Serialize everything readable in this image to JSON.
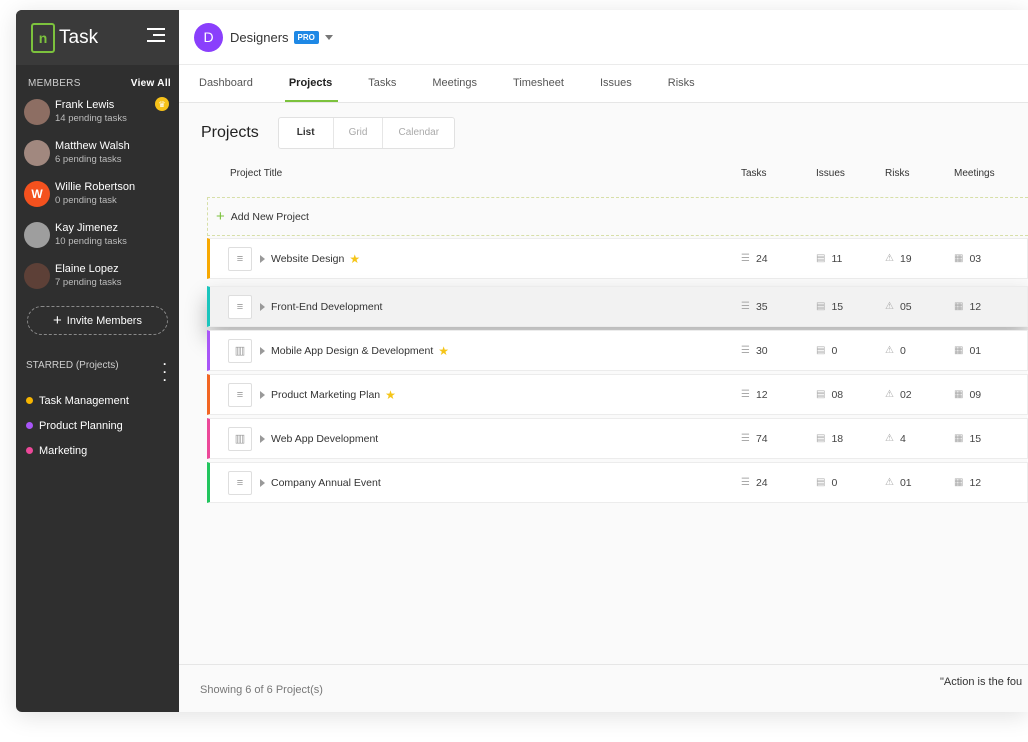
{
  "app": {
    "logo_mark": "n",
    "logo_text": "Task"
  },
  "sidebar": {
    "members_label": "MEMBERS",
    "view_all": "View All",
    "members": [
      {
        "name": "Frank Lewis",
        "sub": "14 pending tasks",
        "initial": "",
        "color": "#8d6e63"
      },
      {
        "name": "Matthew Walsh",
        "sub": "6 pending tasks",
        "initial": "",
        "color": "#a1887f"
      },
      {
        "name": "Willie Robertson",
        "sub": "0 pending task",
        "initial": "W",
        "color": "#f4511e"
      },
      {
        "name": "Kay Jimenez",
        "sub": "10 pending tasks",
        "initial": "",
        "color": "#9e9e9e"
      },
      {
        "name": "Elaine Lopez",
        "sub": "7 pending tasks",
        "initial": "",
        "color": "#5d4037"
      }
    ],
    "invite_label": "Invite Members",
    "starred_label": "STARRED (Projects)",
    "starred": [
      {
        "label": "Task Management",
        "color": "#f7b500"
      },
      {
        "label": "Product Planning",
        "color": "#a855f7"
      },
      {
        "label": "Marketing",
        "color": "#ec4899"
      }
    ]
  },
  "workspace": {
    "initial": "D",
    "name": "Designers",
    "badge": "PRO"
  },
  "tabs": [
    "Dashboard",
    "Projects",
    "Tasks",
    "Meetings",
    "Timesheet",
    "Issues",
    "Risks"
  ],
  "page": {
    "title": "Projects",
    "views": [
      "List",
      "Grid",
      "Calendar"
    ]
  },
  "table": {
    "headers": {
      "title": "Project Title",
      "tasks": "Tasks",
      "issues": "Issues",
      "risks": "Risks",
      "meetings": "Meetings"
    },
    "add_label": "Add New Project",
    "rows": [
      {
        "title": "Website Design",
        "starred": true,
        "color": "#f7a800",
        "tasks": "24",
        "issues": "11",
        "risks": "19",
        "meetings": "03",
        "icon": "list"
      },
      {
        "title": "Front-End Development",
        "starred": false,
        "color": "#1bc5bd",
        "tasks": "35",
        "issues": "15",
        "risks": "05",
        "meetings": "12",
        "icon": "list"
      },
      {
        "title": "Mobile App Design & Development",
        "starred": true,
        "color": "#a855f7",
        "tasks": "30",
        "issues": "0",
        "risks": "0",
        "meetings": "01",
        "icon": "board"
      },
      {
        "title": "Product Marketing Plan",
        "starred": true,
        "color": "#f26522",
        "tasks": "12",
        "issues": "08",
        "risks": "02",
        "meetings": "09",
        "icon": "list"
      },
      {
        "title": "Web App Development",
        "starred": false,
        "color": "#ec4899",
        "tasks": "74",
        "issues": "18",
        "risks": "4",
        "meetings": "15",
        "icon": "board"
      },
      {
        "title": "Company Annual Event",
        "starred": false,
        "color": "#22c55e",
        "tasks": "24",
        "issues": "0",
        "risks": "01",
        "meetings": "12",
        "icon": "list"
      }
    ]
  },
  "footer": {
    "count": "Showing 6 of 6 Project(s)",
    "quote": "\"Action is the fou"
  }
}
